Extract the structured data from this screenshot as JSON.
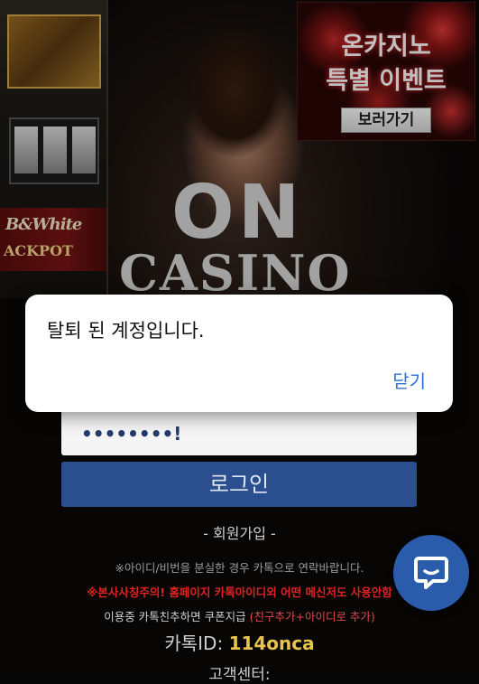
{
  "banner": {
    "line1": "온카지노",
    "line2": "특별 이벤트",
    "button_label": "보러가기"
  },
  "background": {
    "jackpot_text1": "B&White",
    "jackpot_text2": "ACKPOT"
  },
  "logo": {
    "top": "ON",
    "bottom": "CASINO"
  },
  "alert": {
    "message": "탈퇴 된 계정입니다.",
    "close_label": "닫기"
  },
  "login": {
    "password_value": "••••••••!",
    "button_label": "로그인",
    "signup_label": "- 회원가입 -"
  },
  "info": {
    "lost_account": "※아이디/비번을 분실한 경우 카톡으로 연락바랍니다.",
    "warning": "※본사사칭주의! 홈페이지 카톡아이디외 어떤 메신저도 사용안함",
    "friend_prefix": "이용중 카톡친추하면 쿠폰지급 ",
    "friend_highlight": "(친구추가+아이디로 추가)",
    "kakao_label": "카톡ID: ",
    "kakao_id": "114onca",
    "support_center": "고객센터:"
  },
  "colors": {
    "login_button": "#2a4e8e",
    "chat_fab": "#2a5cab",
    "alert_close": "#2f6fd8",
    "warning_text": "#e02222",
    "kakao_id": "#e8c548"
  }
}
